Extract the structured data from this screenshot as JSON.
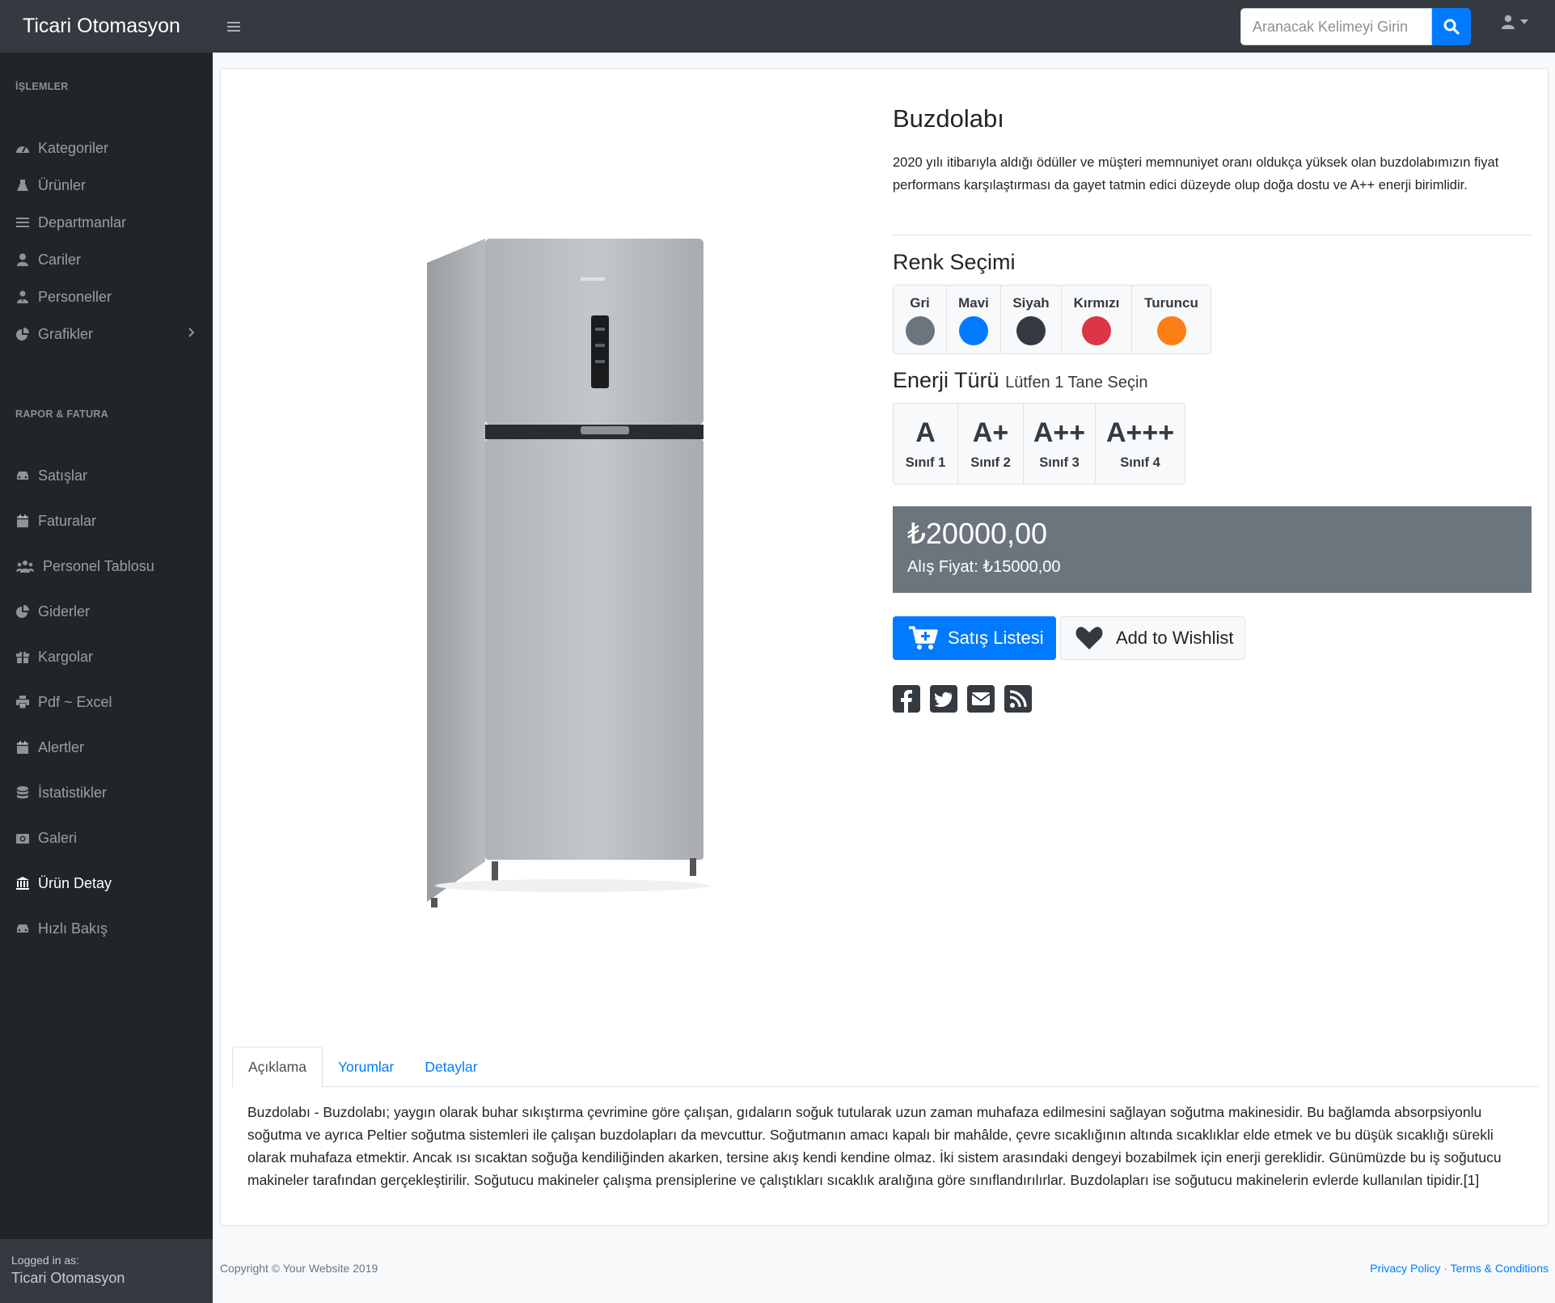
{
  "app": {
    "brand": "Ticari Otomasyon"
  },
  "search": {
    "placeholder": "Aranacak Kelimeyi Girin"
  },
  "sidebar": {
    "section1": "İŞLEMLER",
    "items1": [
      {
        "label": "Kategoriler",
        "icon": "dashboard-icon"
      },
      {
        "label": "Ürünler",
        "icon": "flask-icon"
      },
      {
        "label": "Departmanlar",
        "icon": "list-icon"
      },
      {
        "label": "Cariler",
        "icon": "user-icon"
      },
      {
        "label": "Personeller",
        "icon": "user-tie-icon"
      },
      {
        "label": "Grafikler",
        "icon": "pie-chart-icon"
      }
    ],
    "section2": "RAPOR & FATURA",
    "items2": [
      {
        "label": "Satışlar",
        "icon": "car-icon"
      },
      {
        "label": "Faturalar",
        "icon": "calendar-icon"
      },
      {
        "label": "Personel Tablosu",
        "icon": "users-icon"
      },
      {
        "label": "Giderler",
        "icon": "pie-chart-icon"
      },
      {
        "label": "Kargolar",
        "icon": "gift-icon"
      },
      {
        "label": "Pdf ~ Excel",
        "icon": "print-icon"
      },
      {
        "label": "Alertler",
        "icon": "calendar-icon"
      },
      {
        "label": "İstatistikler",
        "icon": "database-icon"
      },
      {
        "label": "Galeri",
        "icon": "camera-icon"
      },
      {
        "label": "Ürün Detay",
        "icon": "bank-icon"
      },
      {
        "label": "Hızlı Bakış",
        "icon": "car-icon"
      }
    ],
    "footer": {
      "logged_in_label": "Logged in as:",
      "user": "Ticari Otomasyon"
    }
  },
  "product": {
    "title": "Buzdolabı",
    "description": "2020 yılı itibarıyla aldığı ödüller ve müşteri memnuniyet oranı oldukça yüksek olan buzdolabımızın fiyat performans karşılaştırması da gayet tatmin edici düzeyde olup doğa dostu ve A++ enerji birimlidir.",
    "color_title": "Renk Seçimi",
    "colors": [
      {
        "label": "Gri",
        "hex": "#6c757d"
      },
      {
        "label": "Mavi",
        "hex": "#007bff"
      },
      {
        "label": "Siyah",
        "hex": "#343a40"
      },
      {
        "label": "Kırmızı",
        "hex": "#dc3545"
      },
      {
        "label": "Turuncu",
        "hex": "#fd7e14"
      }
    ],
    "energy_title": "Enerji Türü",
    "energy_hint": "Lütfen 1 Tane Seçin",
    "energy": [
      {
        "grade": "A",
        "class": "Sınıf 1"
      },
      {
        "grade": "A+",
        "class": "Sınıf 2"
      },
      {
        "grade": "A++",
        "class": "Sınıf 3"
      },
      {
        "grade": "A+++",
        "class": "Sınıf 4"
      }
    ],
    "price": "₺20000,00",
    "buy_price": "Alış Fiyat: ₺15000,00",
    "cart_label": "Satış Listesi",
    "wishlist_label": "Add to Wishlist"
  },
  "tabs": [
    {
      "label": "Açıklama"
    },
    {
      "label": "Yorumlar"
    },
    {
      "label": "Detaylar"
    }
  ],
  "tab_content": "Buzdolabı - Buzdolabı; yaygın olarak buhar sıkıştırma çevrimine göre çalışan, gıdaların soğuk tutularak uzun zaman muhafaza edilmesini sağlayan soğutma makinesidir. Bu bağlamda absorpsiyonlu soğutma ve ayrıca Peltier soğutma sistemleri ile çalışan buzdolapları da mevcuttur. Soğutmanın amacı kapalı bir mahâlde, çevre sıcaklığının altında sıcaklıklar elde etmek ve bu düşük sıcaklığı sürekli olarak muhafaza etmektir. Ancak ısı sıcaktan soğuğa kendiliğinden akarken, tersine akış kendi kendine olmaz. İki sistem arasındaki dengeyi bozabilmek için enerji gereklidir. Günümüzde bu iş soğutucu makineler tarafından gerçekleştirilir. Soğutucu makineler çalışma prensiplerine ve çalıştıkları sıcaklık aralığına göre sınıflandırılırlar. Buzdolapları ise soğutucu makinelerin evlerde kullanılan tipidir.[1]",
  "footer": {
    "copyright": "Copyright © Your Website 2019",
    "privacy": "Privacy Policy",
    "separator": "·",
    "terms": "Terms & Conditions"
  }
}
